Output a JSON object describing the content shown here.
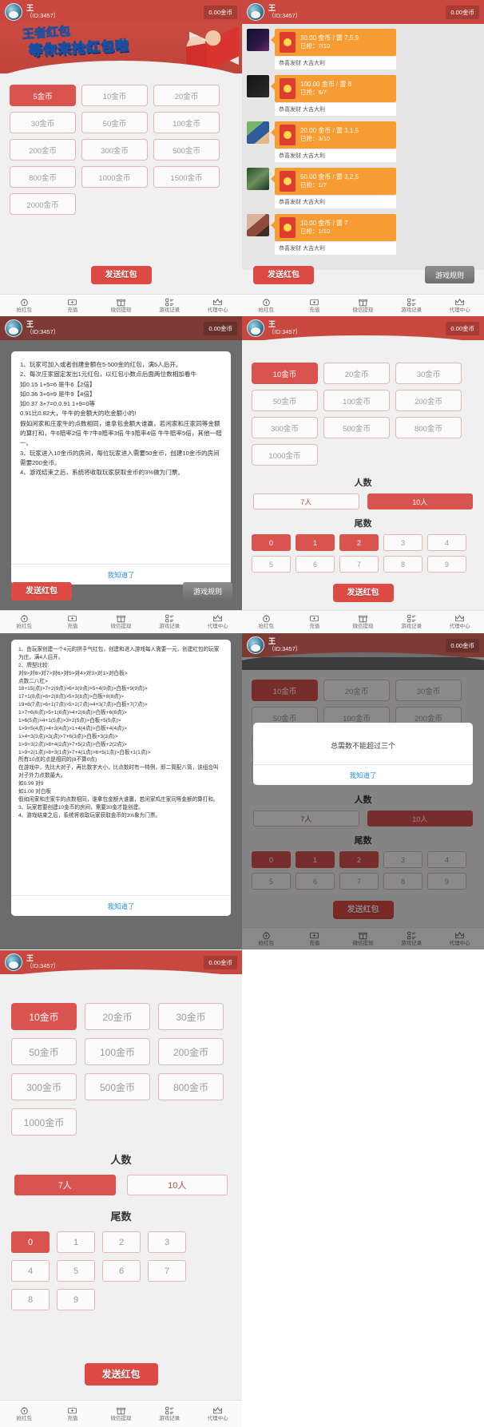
{
  "app": {
    "user_name": "王",
    "user_id": "（ID:3457）",
    "coin_balance": "0.00金币",
    "banner_text": "等你来抢红包啦",
    "banner_text_top": "王者红包"
  },
  "tabbar": {
    "items": [
      {
        "icon": "red-packet-icon",
        "label": "抢红包"
      },
      {
        "icon": "recharge-icon",
        "label": "充值"
      },
      {
        "icon": "withdraw-icon",
        "label": "微信提现"
      },
      {
        "icon": "records-icon",
        "label": "游戏记录"
      },
      {
        "icon": "agent-crown-icon",
        "label": "代理中心"
      }
    ]
  },
  "buttons": {
    "send_red_packet": "发送红包",
    "game_rules": "游戏规则",
    "ok_got_it": "我知道了"
  },
  "panel1": {
    "amounts": [
      "5金币",
      "10金币",
      "20金币",
      "30金币",
      "50金币",
      "100金币",
      "200金币",
      "300金币",
      "500金币",
      "800金币",
      "1000金币",
      "1500金币",
      "2000金币"
    ],
    "selected_index": 0
  },
  "panel2": {
    "chats": [
      {
        "avatar": "a1",
        "amount": "30.00 金币 / 雷 7,5,9",
        "grabbed": "已抢：7/10",
        "note": "恭喜发财 大吉大利"
      },
      {
        "avatar": "a2",
        "amount": "100.00 金币 / 雷 8",
        "grabbed": "已抢：6/7",
        "note": "恭喜发财 大吉大利"
      },
      {
        "avatar": "a3",
        "amount": "20.00 金币 / 雷 3,1,5",
        "grabbed": "已抢：3/10",
        "note": "恭喜发财 大吉大利"
      },
      {
        "avatar": "a4",
        "amount": "50.00 金币 / 雷 3,2,5",
        "grabbed": "已抢：1/7",
        "note": "恭喜发财 大吉大利"
      },
      {
        "avatar": "a5",
        "amount": "10.00 金币 / 雷 7",
        "grabbed": "已抢：1/10",
        "note": "恭喜发财 大吉大利"
      }
    ]
  },
  "panel3": {
    "rules": [
      "1、玩家可加入或者创建金额在5-500金的红包，满5人后开。",
      "2、每次庄家固定发出1元红包，以红包小数点后面两位数相加看牛",
      "如0.15 1+5=6 是牛6【2倍】",
      "如0.36 3+6=9 是牛9【4倍】",
      "如0.37 3+7=0,0.91 1+9=0等",
      "0.91比0.82大，牛牛的金额大的吃金额小的!",
      "假如闲家和庄家牛的点数相同，谁拿包金额大谁赢，若闲家和庄家同等金额的算打和，牛6赔率2倍 牛7牛8赔率3倍 牛9赔率4倍 牛牛赔率5倍，其他一赔一。",
      "3、玩家进入10金币的房间，每位玩家进入需要50金币，创建10金币的房间需要200金币。",
      "4、游戏结束之后，系统将收取玩家获取金币的3%做为门票。"
    ]
  },
  "panel4": {
    "amounts": [
      "10金币",
      "20金币",
      "30金币",
      "50金币",
      "100金币",
      "200金币",
      "300金币",
      "500金币",
      "800金币",
      "1000金币"
    ],
    "selected_index": 0,
    "people_title": "人数",
    "people_options": [
      "7人",
      "10人"
    ],
    "people_selected_index": 1,
    "tail_title": "尾数",
    "tail_options": [
      "0",
      "1",
      "2",
      "3",
      "4",
      "5",
      "6",
      "7",
      "8",
      "9"
    ],
    "tail_selected": [
      0,
      1,
      2
    ]
  },
  "panel5": {
    "rules": [
      "1、由玩家创建一个4元的拼手气红包，创建和进入游戏每人需要一元，创建红包的玩家为庄，满4人后开。",
      "2、牌型比较:",
      "对9>对8>对7>对6>对5>对4>对3>对1>对白板>",
      "点数二八杠>",
      "18+15(点)>7+2(9点)>6+3(9点)>5+4(9点)>白板+9(9点)>",
      "17+1(8点)>6+2(8点)>5+3(8点)>白板+8(8点)>",
      "19+8(7点)>6+1(7点)>5+2(7点)>4+3(7点)>白板+7(7点)>",
      "1>7+6(6点)>5+1(6点)>4+2(6点)>白板+6(6点)>",
      "1>6(5点)>4+1(5点)>3+2(5点)>白板+5(5点)>",
      "1>9+5(4点)>4+3(4点)>1+4(4点)>白板+4(4点)>",
      "1>4+3(3点)>3(点)>7+6(3点)>白板+3(3点)>",
      "1>9+3(2点)>8+4(2点)>7+5(2点)>白板+2(2点)>",
      "1>9+2(1点)>8+3(1点)>7+4(1点)>6+5(1点)>白板+1(1点)>",
      "所有10点的点是相同的(8不算0点)",
      "在游戏中，先比大对子，再比数字大小，比点数时有一特例，即二筒配八筒，该组合叫对子外力点数最大。",
      "如0.99 对9",
      "如1.00 对白板",
      "假如闲家和庄家牛的点数相同，谁拿包金额大谁赢，若闲家鸡庄家同等金额的算打和。",
      "3、玩家若要创建10金币的房间，需要30金才能创建。",
      "4、游戏结束之后，系统将收取玩家获取金币的3%象为门票。"
    ]
  },
  "panel6": {
    "alert_message": "总需数不能超过三个"
  },
  "panel7": {
    "amounts": [
      "10金币",
      "20金币",
      "30金币",
      "50金币",
      "100金币",
      "200金币",
      "300金币",
      "500金币",
      "800金币",
      "1000金币"
    ],
    "selected_index": 0,
    "people_title": "人数",
    "people_options": [
      "7人",
      "10人"
    ],
    "people_selected_index": 0,
    "tail_title": "尾数",
    "tail_options": [
      "0",
      "1",
      "2",
      "3",
      "4",
      "5",
      "6",
      "7",
      "8",
      "9"
    ],
    "tail_selected": [
      0
    ]
  },
  "colors": {
    "brand_red": "#c8483f",
    "accent_red": "#d9534f",
    "packet_orange": "#f79b33",
    "panel_bg": "#f0f0f0"
  }
}
